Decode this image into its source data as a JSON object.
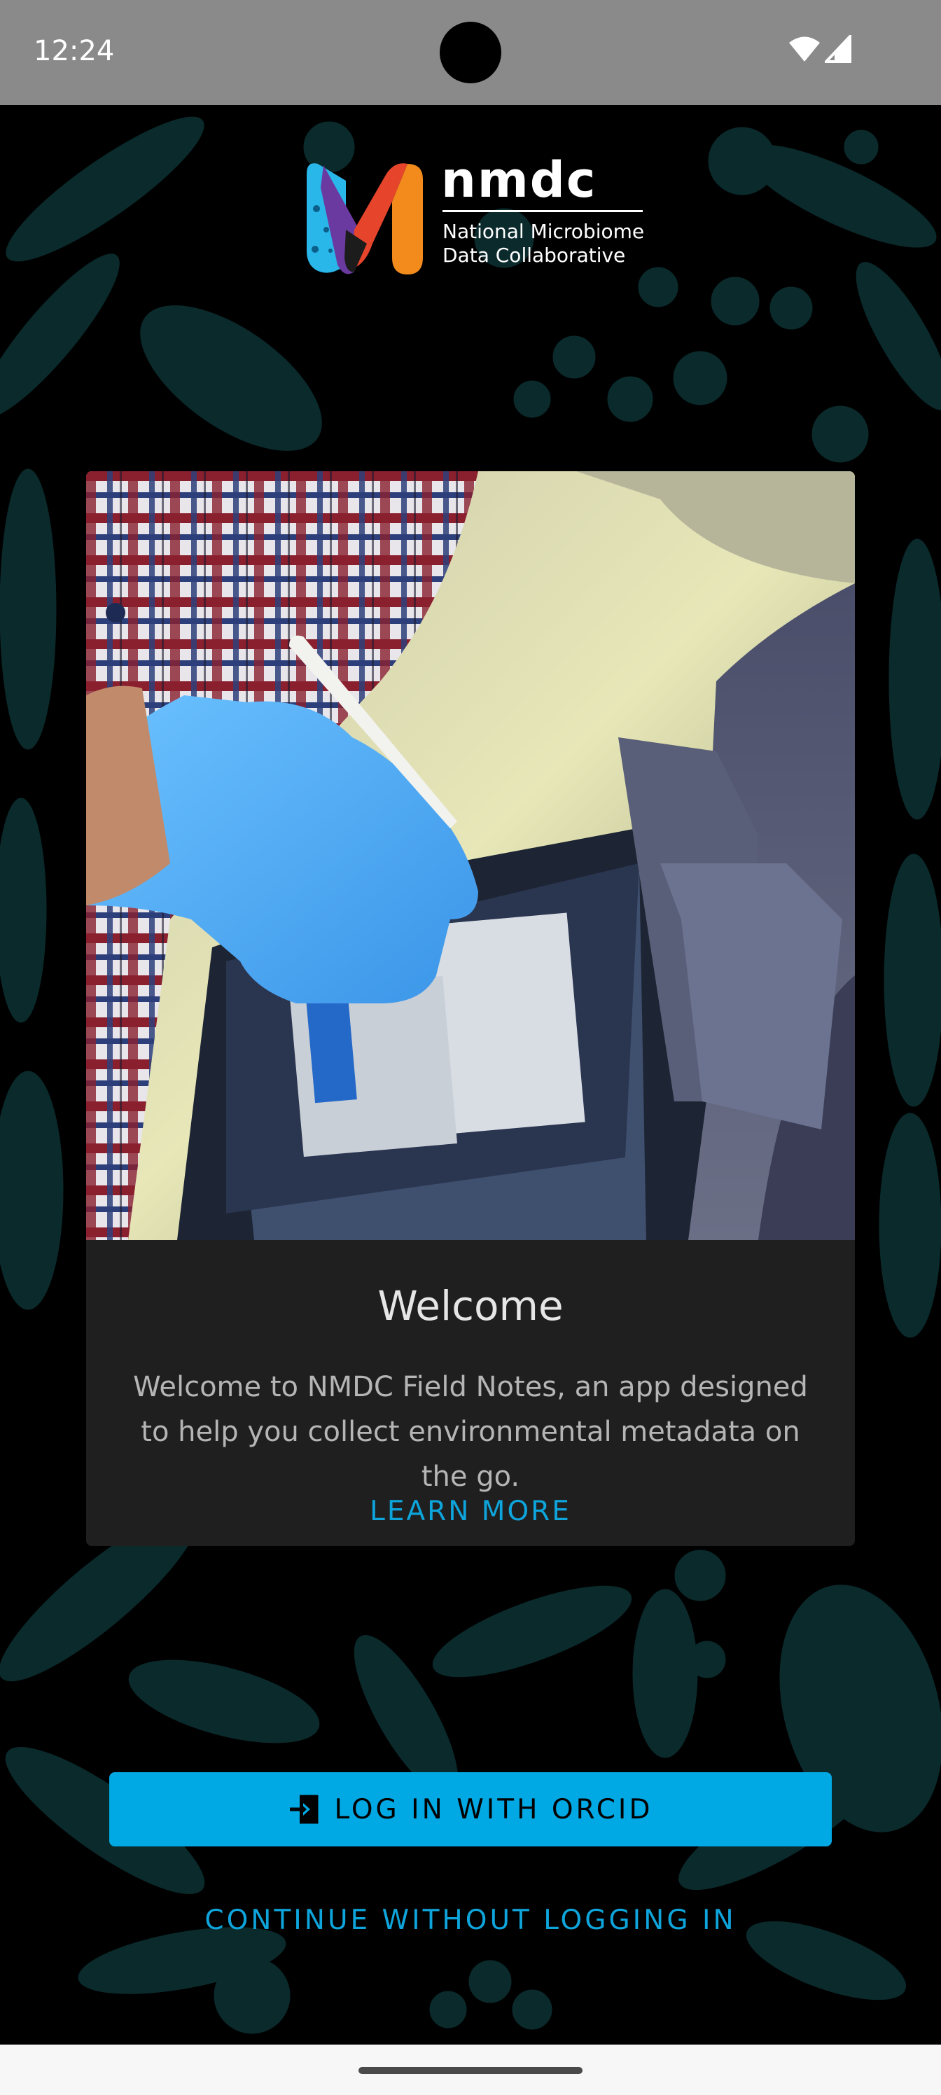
{
  "status_bar": {
    "time": "12:24",
    "icons": [
      "wifi-icon",
      "cellular-signal-icon"
    ]
  },
  "logo": {
    "wordmark": "nmdc",
    "line1": "National Microbiome",
    "line2": "Data Collaborative"
  },
  "welcome_card": {
    "image_description": "Gloved hand writing with a stylus on a tablet showing a sample form",
    "title": "Welcome",
    "body": "Welcome to NMDC Field Notes, an app designed to help you collect environmental metadata on the go.",
    "learn_more_label": "LEARN MORE"
  },
  "actions": {
    "login_label": "LOG IN WITH ORCID",
    "login_icon": "login-icon",
    "continue_label": "CONTINUE WITHOUT LOGGING IN"
  },
  "colors": {
    "accent": "#01A9E4",
    "link": "#0EA5DC",
    "card_bg": "#1F1F1F",
    "status_bar_bg": "#8A8A8A",
    "pattern": "#0B2A2C"
  }
}
